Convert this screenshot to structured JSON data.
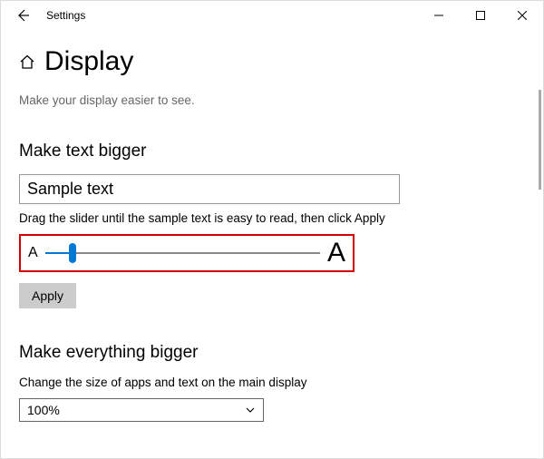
{
  "window": {
    "title": "Settings"
  },
  "page": {
    "title": "Display",
    "subtitle": "Make your display easier to see."
  },
  "text_bigger": {
    "section_title": "Make text bigger",
    "sample_text": "Sample text",
    "instruction": "Drag the slider until the sample text is easy to read, then click Apply",
    "letter_small": "A",
    "letter_big": "A",
    "slider_percent": 10,
    "apply_label": "Apply"
  },
  "everything_bigger": {
    "section_title": "Make everything bigger",
    "instruction": "Change the size of apps and text on the main display",
    "dropdown_value": "100%"
  }
}
